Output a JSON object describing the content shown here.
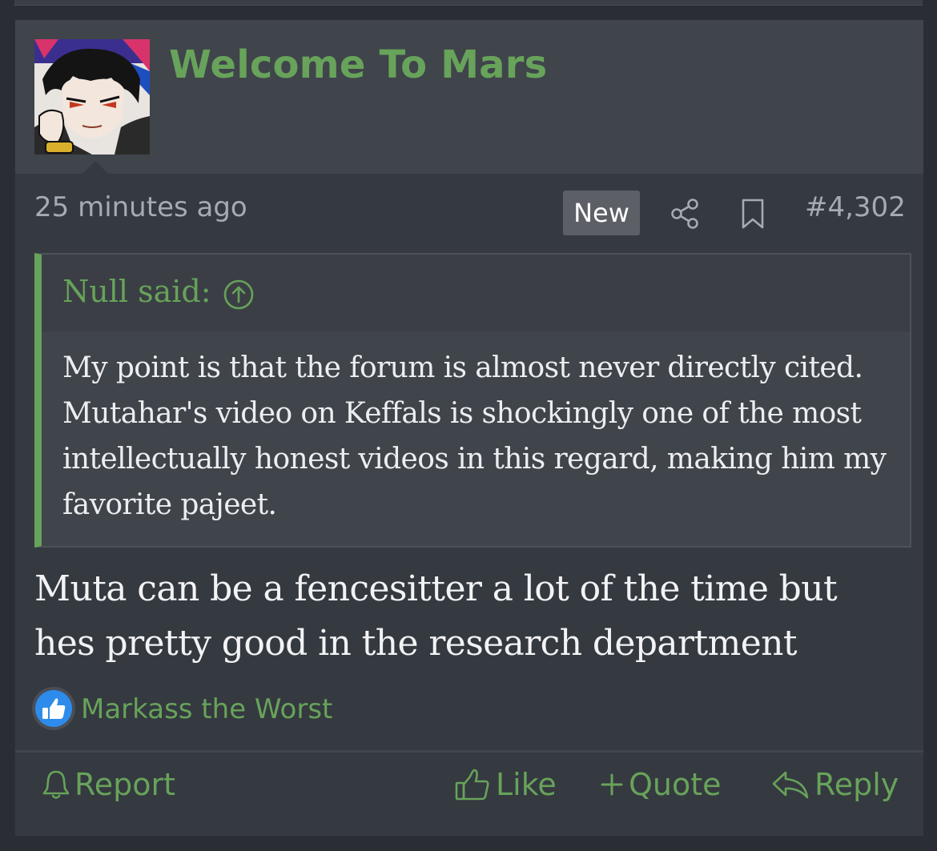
{
  "post": {
    "username": "Welcome To Mars",
    "timestamp": "25 minutes ago",
    "new_badge": "New",
    "post_number": "#4,302",
    "quote": {
      "author": "Null said:",
      "body": "My point is that the forum is almost never directly cited. Mutahar's video on Keffals is shockingly one of the most intellectually honest videos in this regard, making him my favorite pajeet."
    },
    "message": "Muta can be a fencesitter a lot of the time but hes pretty good in the research department",
    "reactions": {
      "icon": "thumbs-up-icon",
      "users": "Markass the Worst"
    },
    "actions": {
      "report": "Report",
      "like": "Like",
      "quote": "Quote",
      "reply": "Reply"
    }
  },
  "colors": {
    "accent": "#67a35a",
    "background": "#2a2d33",
    "post_bg": "#353940",
    "header_bg": "#40444b",
    "meta_text": "#a6abb3",
    "reaction_blue": "#2d8ceb"
  }
}
